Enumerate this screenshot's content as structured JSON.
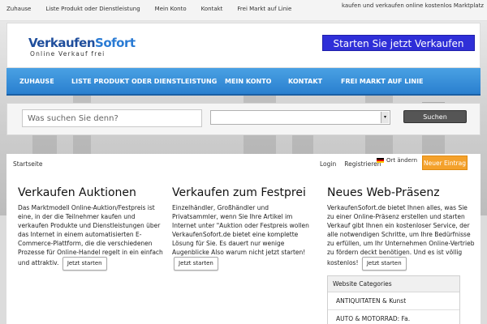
{
  "topbar": {
    "links": [
      "Zuhause",
      "Liste Produkt oder Dienstleistung",
      "Mein Konto",
      "Kontakt",
      "Frei Markt auf Linie"
    ],
    "tagline": "kaufen und verkaufen online kostenlos Marktplatz"
  },
  "header": {
    "logo_part1": "Verkaufen",
    "logo_part2": "Sofort",
    "logo_sub": "Online Verkauf frei",
    "cta": "Starten Sie jetzt Verkaufen"
  },
  "nav": {
    "items": [
      "ZUHAUSE",
      "LISTE PRODUKT ODER DIENSTLEISTUNG",
      "MEIN KONTO",
      "KONTAKT",
      "FREI MARKT AUF LINIE"
    ]
  },
  "search": {
    "placeholder": "Was suchen Sie denn?",
    "button": "Suchen"
  },
  "content": {
    "breadcrumb": "Startseite",
    "login": "Login",
    "register": "Registrieren",
    "locale": "Ort ändern",
    "new_entry": "Neuer Eintrag",
    "columns": [
      {
        "title": "Verkaufen Auktionen",
        "text": "Das Marktmodell Online-Auktion/Festpreis ist eine, in der die Teilnehmer kaufen und verkaufen Produkte und Dienstleistungen über das Internet in einem automatisierten E-Commerce-Plattform, die die verschiedenen Prozesse für Online-Handel regelt in ein einfach und attraktiv.",
        "button": "Jetzt starten"
      },
      {
        "title": "Verkaufen zum Festprei",
        "text": "Einzelhändler, Großhändler und Privatsammler, wenn Sie Ihre Artikel im Internet unter \"Auktion oder Festpreis wollen VerkaufenSofort.de bietet eine komplette Lösung für Sie. Es dauert nur wenige Augenblicke Also warum nicht jetzt starten!",
        "button": "Jetzt starten"
      },
      {
        "title": "Neues Web-Präsenz",
        "text": "VerkaufenSofort.de bietet Ihnen alles, was Sie zu einer Online-Präsenz erstellen und starten Verkauf gibt Ihnen ein kostenloser Service, der alle notwendigen Schritte, um Ihre Bedürfnisse zu erfüllen, um Ihr Unternehmen Online-Vertrieb zu fördern deckt benötigen. Und es ist völlig kostenlos!",
        "button": "Jetzt starten"
      }
    ],
    "categories": {
      "header": "Website Categories",
      "items": [
        "ANTIQUITATEN & Kunst",
        "AUTO & MOTORRAD: Fa."
      ]
    }
  },
  "colors": {
    "nav_blue": "#2a7fcf",
    "cta_blue": "#2f2fd8",
    "orange": "#f4a12b"
  }
}
